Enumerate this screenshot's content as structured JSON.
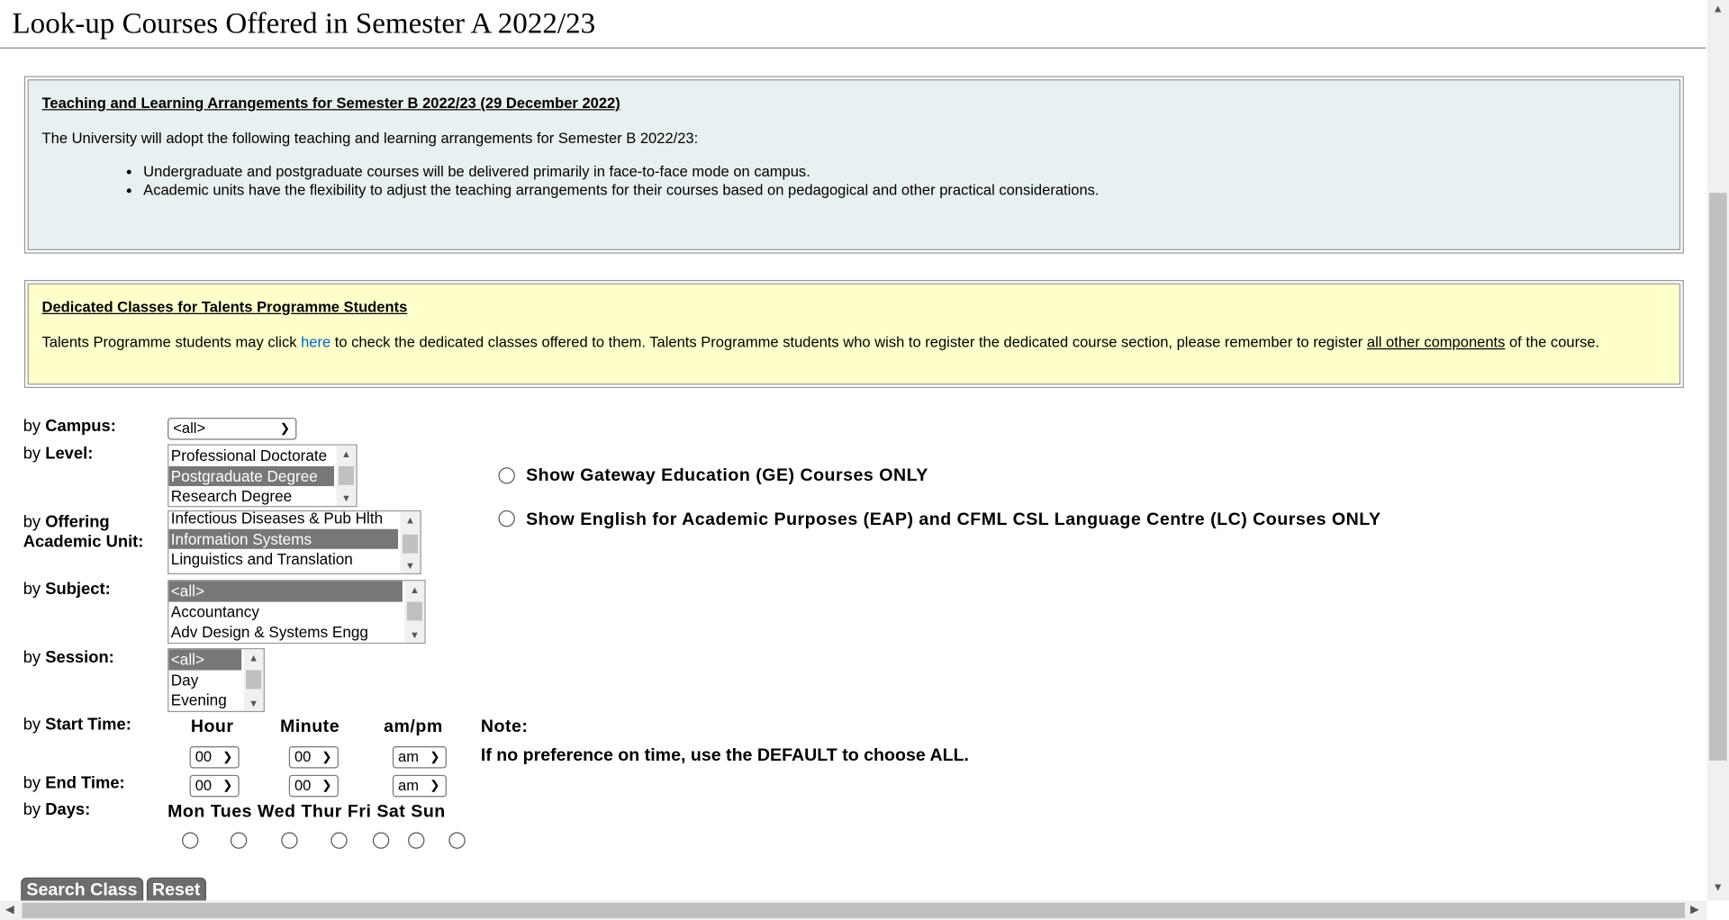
{
  "page": {
    "title": "Look-up Courses Offered in Semester A 2022/23"
  },
  "notice_blue": {
    "heading": "Teaching and Learning Arrangements for Semester B 2022/23 (29 December 2022)",
    "intro": "The University will adopt the following teaching and learning arrangements for Semester B 2022/23:",
    "bullets": [
      "Undergraduate and postgraduate courses will be delivered primarily in face-to-face mode on campus.",
      "Academic units have the flexibility to adjust the teaching arrangements for their courses based on pedagogical and other practical considerations."
    ]
  },
  "notice_yellow": {
    "heading": "Dedicated Classes for Talents Programme Students",
    "text_1": "Talents Programme students may click ",
    "link_here": "here",
    "text_2": " to check the dedicated classes offered to them. Talents Programme students who wish to register the dedicated course section, please remember to register ",
    "link_components": "all other components",
    "text_3": " of the course."
  },
  "form": {
    "campus": {
      "by": "by ",
      "label": "Campus:",
      "value": "<all>"
    },
    "level": {
      "by": "by ",
      "label": "Level:",
      "options": [
        "Professional Doctorate",
        "Postgraduate Degree",
        "Research Degree"
      ],
      "selected": "Postgraduate Degree"
    },
    "unit": {
      "by": "by ",
      "label_1": "Offering",
      "label_2": "Academic Unit:",
      "options": [
        "Infectious Diseases & Pub Hlth",
        "Information Systems",
        "Linguistics and Translation"
      ],
      "selected": "Information Systems"
    },
    "subject": {
      "by": "by ",
      "label": "Subject:",
      "options": [
        "<all>",
        "Accountancy",
        "Adv Design & Systems Engg"
      ],
      "selected": "<all>"
    },
    "session": {
      "by": "by ",
      "label": "Session:",
      "options": [
        "<all>",
        "Day",
        "Evening"
      ],
      "selected": "<all>"
    },
    "start_time": {
      "by": "by ",
      "label": "Start Time:",
      "hour": "00",
      "minute": "00",
      "ampm": "am"
    },
    "end_time": {
      "by": "by ",
      "label": "End Time:",
      "hour": "00",
      "minute": "00",
      "ampm": "am"
    },
    "time_headers": {
      "hour": "Hour",
      "minute": "Minute",
      "ampm": "am/pm"
    },
    "note_label": "Note:",
    "note_text": "If no preference on time, use the DEFAULT to choose ALL.",
    "days": {
      "by": "by ",
      "label": "Days:",
      "names": [
        "Mon",
        "Tues",
        "Wed",
        "Thur",
        "Fri",
        "Sat",
        "Sun"
      ]
    },
    "ge_option": "Show Gateway Education (GE) Courses ONLY",
    "eap_option": "Show English for Academic Purposes (EAP) and CFML CSL Language Centre (LC) Courses ONLY",
    "search_button": "Search Class",
    "reset_button": "Reset"
  }
}
